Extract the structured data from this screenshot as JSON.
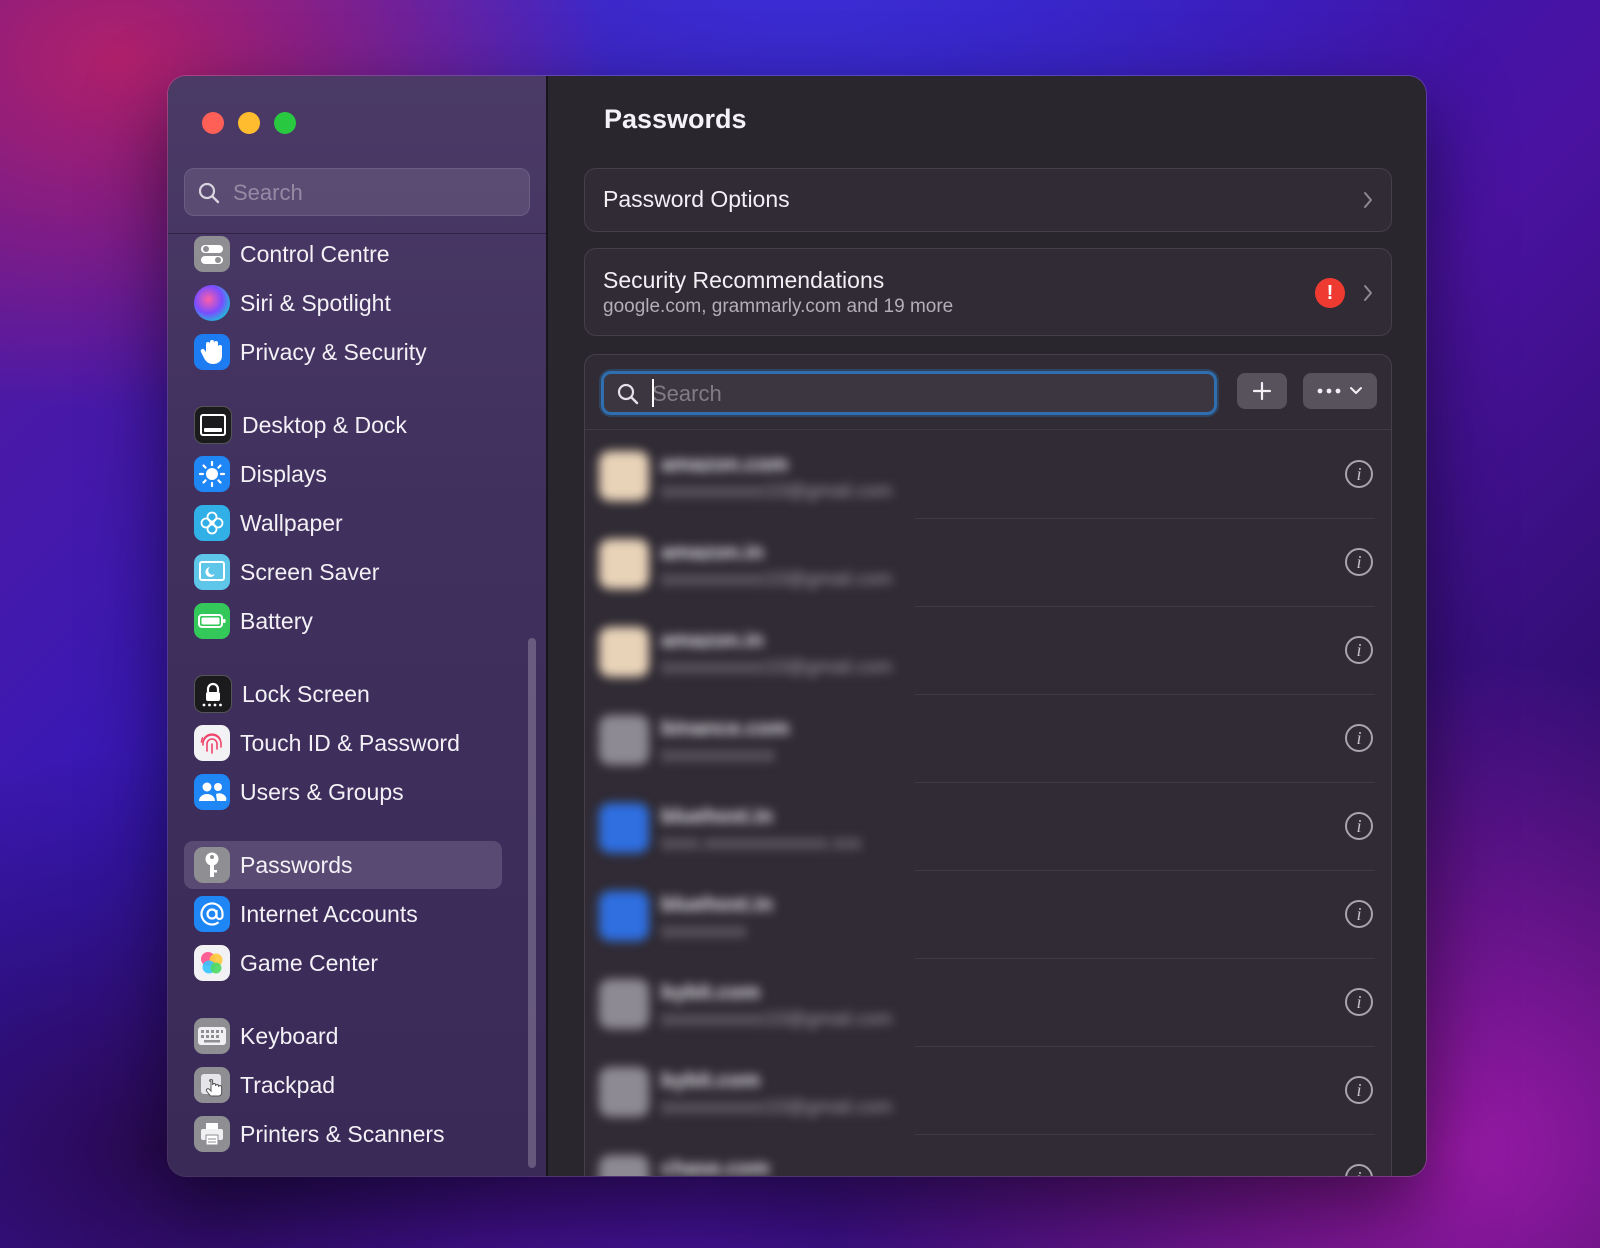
{
  "window": {
    "traffic_lights": [
      "close",
      "minimize",
      "zoom"
    ]
  },
  "sidebar": {
    "search_placeholder": "Search",
    "items": [
      {
        "label": "Control Centre",
        "icon": "control-centre-icon",
        "color": "#8e8e93"
      },
      {
        "label": "Siri & Spotlight",
        "icon": "siri-icon",
        "color": "#3b2a72"
      },
      {
        "label": "Privacy & Security",
        "icon": "hand-icon",
        "color": "#1e7cf2"
      },
      {
        "label": "Desktop & Dock",
        "icon": "dock-icon",
        "color": "#1b1b1d"
      },
      {
        "label": "Displays",
        "icon": "sun-icon",
        "color": "#1f86f5"
      },
      {
        "label": "Wallpaper",
        "icon": "flower-icon",
        "color": "#31b0e8"
      },
      {
        "label": "Screen Saver",
        "icon": "screen-saver-icon",
        "color": "#5ec6e8"
      },
      {
        "label": "Battery",
        "icon": "battery-icon",
        "color": "#34c759"
      },
      {
        "label": "Lock Screen",
        "icon": "lock-icon",
        "color": "#1b1b1d"
      },
      {
        "label": "Touch ID & Password",
        "icon": "fingerprint-icon",
        "color": "#f2f2f4"
      },
      {
        "label": "Users & Groups",
        "icon": "users-icon",
        "color": "#1f86f5"
      },
      {
        "label": "Passwords",
        "icon": "key-icon",
        "color": "#8e8e93"
      },
      {
        "label": "Internet Accounts",
        "icon": "at-icon",
        "color": "#1f86f5"
      },
      {
        "label": "Game Center",
        "icon": "game-center-icon",
        "color": "#f2f2f4"
      },
      {
        "label": "Keyboard",
        "icon": "keyboard-icon",
        "color": "#8e8e93"
      },
      {
        "label": "Trackpad",
        "icon": "trackpad-icon",
        "color": "#8e8e93"
      },
      {
        "label": "Printers & Scanners",
        "icon": "printer-icon",
        "color": "#8e8e93"
      }
    ],
    "selected": "Passwords"
  },
  "main": {
    "title": "Passwords",
    "password_options": {
      "label": "Password Options"
    },
    "security": {
      "label": "Security Recommendations",
      "subtitle": "google.com, grammarly.com and 19 more",
      "alert_glyph": "!"
    },
    "search_placeholder": "Search",
    "add_glyph": "+",
    "more_glyph": "•••",
    "rows": [
      {
        "site": "amazon.com",
        "user": "sxxxxxxxxxx10@gmail.com",
        "icon_color": "#e9d3b8",
        "info": "i"
      },
      {
        "site": "amazon.in",
        "user": "sxxxxxxxxxx10@gmail.com",
        "icon_color": "#e9d3b8",
        "info": "i"
      },
      {
        "site": "amazon.in",
        "user": "sxxxxxxxxxx10@gmail.com",
        "icon_color": "#e9d3b8",
        "info": "i"
      },
      {
        "site": "binance.com",
        "user": "sxxxxxxxxxxx",
        "icon_color": "#8e8a93",
        "info": "i"
      },
      {
        "site": "bluehost.in",
        "user": "sxxx.xxxxxxxxxxxxx.xxx",
        "icon_color": "#2f6fe0",
        "info": "i"
      },
      {
        "site": "bluehost.in",
        "user": "sxxxxxxxx",
        "icon_color": "#2f6fe0",
        "info": "i"
      },
      {
        "site": "bybit.com",
        "user": "sxxxxxxxxxx10@gmail.com",
        "icon_color": "#8e8a93",
        "info": "i"
      },
      {
        "site": "bybit.com",
        "user": "sxxxxxxxxxx10@gmail.com",
        "icon_color": "#8e8a93",
        "info": "i"
      },
      {
        "site": "chase.com",
        "user": "",
        "icon_color": "#8e8a93",
        "info": "i"
      }
    ]
  }
}
